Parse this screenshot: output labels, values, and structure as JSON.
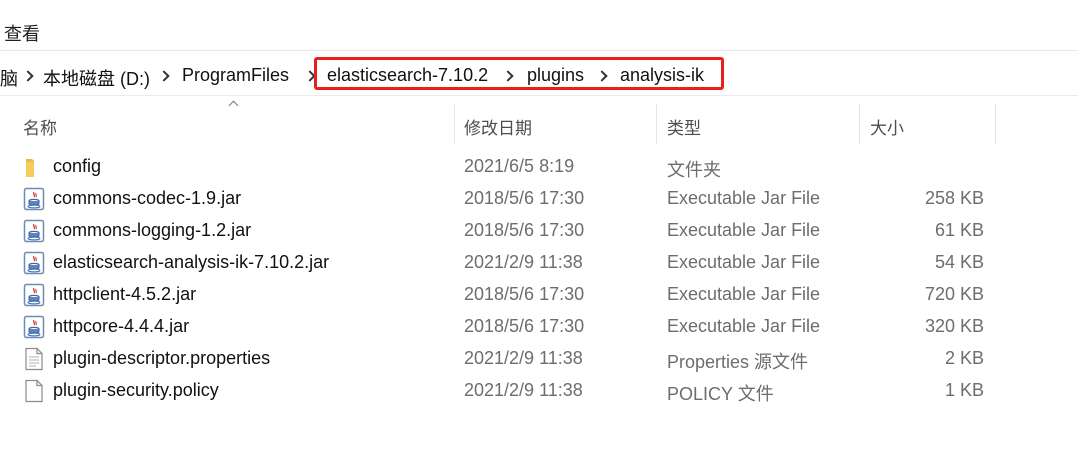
{
  "menu": {
    "view_label": "查看"
  },
  "breadcrumb": {
    "items": [
      {
        "label": "脑"
      },
      {
        "label": "本地磁盘 (D:)"
      },
      {
        "label": "ProgramFiles"
      },
      {
        "label": "elasticsearch-7.10.2"
      },
      {
        "label": "plugins"
      },
      {
        "label": "analysis-ik"
      }
    ],
    "highlight_color": "#e8201c"
  },
  "columns": {
    "name": "名称",
    "date": "修改日期",
    "type": "类型",
    "size": "大小"
  },
  "files": [
    {
      "name": "config",
      "date": "2021/6/5 8:19",
      "type": "文件夹",
      "size": "",
      "icon": "folder-icon"
    },
    {
      "name": "commons-codec-1.9.jar",
      "date": "2018/5/6 17:30",
      "type": "Executable Jar File",
      "size": "258 KB",
      "icon": "jar-file-icon"
    },
    {
      "name": "commons-logging-1.2.jar",
      "date": "2018/5/6 17:30",
      "type": "Executable Jar File",
      "size": "61 KB",
      "icon": "jar-file-icon"
    },
    {
      "name": "elasticsearch-analysis-ik-7.10.2.jar",
      "date": "2021/2/9 11:38",
      "type": "Executable Jar File",
      "size": "54 KB",
      "icon": "jar-file-icon"
    },
    {
      "name": "httpclient-4.5.2.jar",
      "date": "2018/5/6 17:30",
      "type": "Executable Jar File",
      "size": "720 KB",
      "icon": "jar-file-icon"
    },
    {
      "name": "httpcore-4.4.4.jar",
      "date": "2018/5/6 17:30",
      "type": "Executable Jar File",
      "size": "320 KB",
      "icon": "jar-file-icon"
    },
    {
      "name": "plugin-descriptor.properties",
      "date": "2021/2/9 11:38",
      "type": "Properties 源文件",
      "size": "2 KB",
      "icon": "properties-file-icon"
    },
    {
      "name": "plugin-security.policy",
      "date": "2021/2/9 11:38",
      "type": "POLICY 文件",
      "size": "1 KB",
      "icon": "policy-file-icon"
    }
  ]
}
